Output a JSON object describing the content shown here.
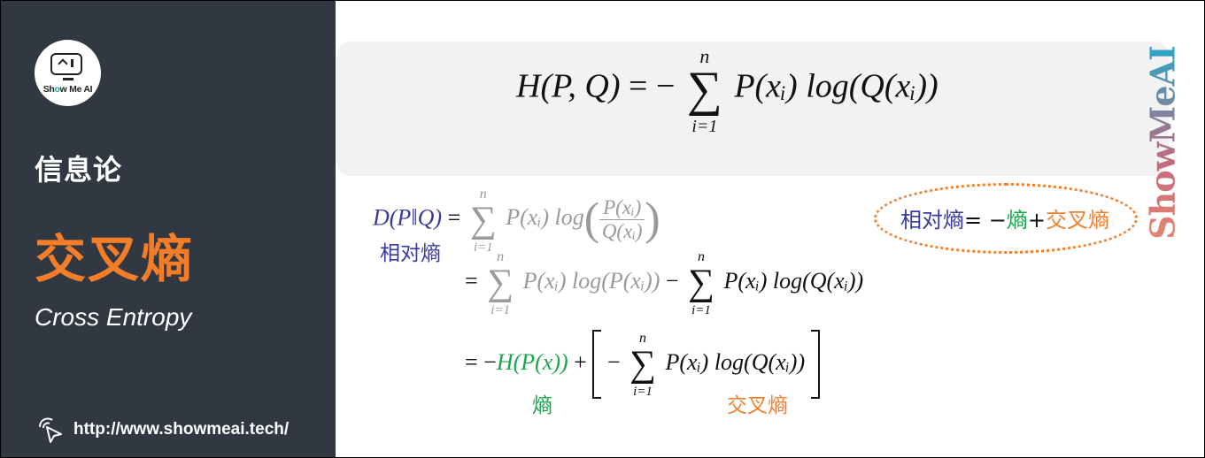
{
  "sidebar": {
    "logo_text_prefix": "Sh",
    "logo_text_o": "o",
    "logo_text_suffix": "w Me AI",
    "topic": "信息论",
    "title_cn": "交叉熵",
    "title_en": "Cross Entropy",
    "link": "http://www.showmeai.tech/"
  },
  "formula_box": {
    "lhs": "H(P, Q)",
    "eq": "= −",
    "sum_upper": "n",
    "sum_lower": "i=1",
    "rhs": "P(xᵢ) log(Q(xᵢ))"
  },
  "derivation": {
    "kl_lhs": "D(P‖Q)",
    "kl_label": "相对熵",
    "line1": {
      "eq": "=",
      "sum_upper": "n",
      "sum_lower": "i=1",
      "term": "P(xᵢ) log",
      "frac_num": "P(xᵢ)",
      "frac_den": "Q(xᵢ)"
    },
    "line2": {
      "eq": "=",
      "sum_upper": "n",
      "sum_lower": "i=1",
      "term_gray": "P(xᵢ) log(P(xᵢ))",
      "minus": "−",
      "sum2_upper": "n",
      "sum2_lower": "i=1",
      "term_black": "P(xᵢ) log(Q(xᵢ))"
    },
    "line3": {
      "eq": "= −",
      "entropy_term": "H(P(x))",
      "plus": "+",
      "minus": "−",
      "sum_upper": "n",
      "sum_lower": "i=1",
      "cross_term": "P(xᵢ) log(Q(xᵢ))",
      "entropy_label": "熵",
      "cross_label": "交叉熵"
    }
  },
  "note": {
    "relative": "相对熵",
    "eq": "= −",
    "entropy": "熵",
    "plus": "+",
    "cross": "交叉熵"
  },
  "watermark": "ShowMeAI",
  "colors": {
    "sidebar_bg": "#323842",
    "accent_orange": "#f47d2a",
    "kl_blue": "#3a3a9e",
    "entropy_green": "#1aa64d",
    "cross_orange": "#f08030",
    "muted_gray": "#9a9a9a"
  }
}
